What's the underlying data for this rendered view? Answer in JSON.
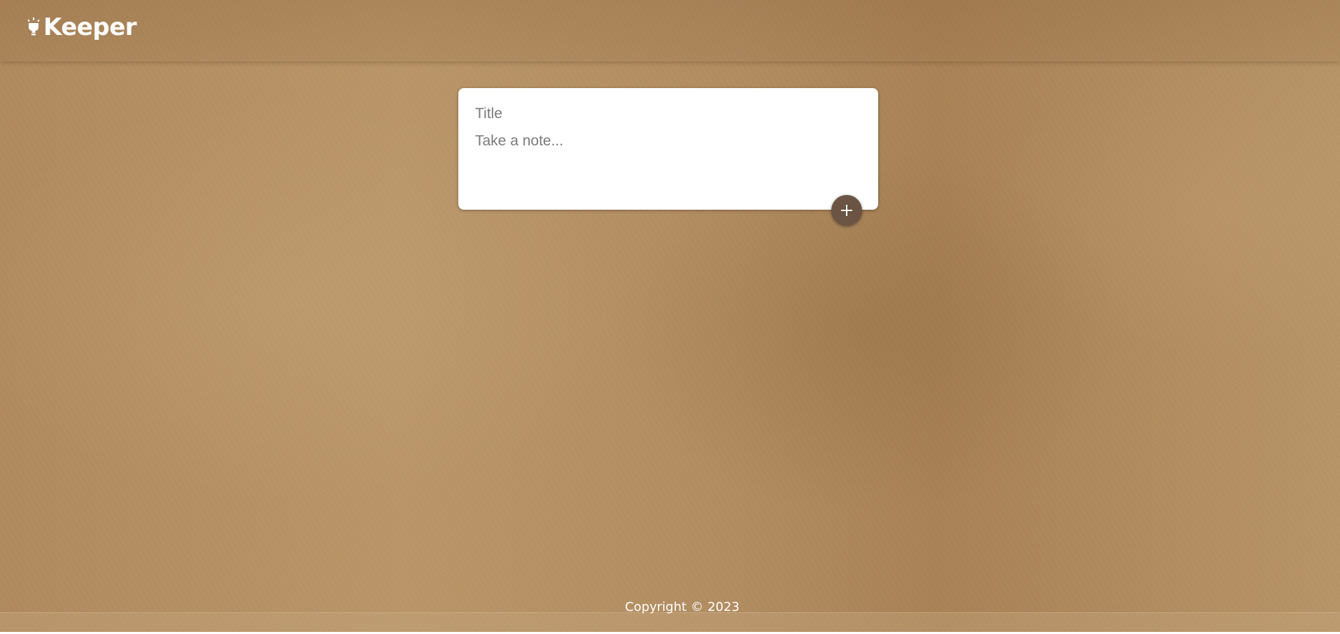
{
  "header": {
    "app_name": "Keeper",
    "logo_icon": "lightbulb-icon"
  },
  "composer": {
    "title_placeholder": "Title",
    "title_value": "",
    "content_placeholder": "Take a note...",
    "content_value": "",
    "add_button_icon": "plus-icon"
  },
  "footer": {
    "copyright_text": "Copyright",
    "copyright_symbol": "©",
    "year": "2023"
  },
  "colors": {
    "background": "#b48f63",
    "composer_background": "#ffffff",
    "add_button": "#6b5443",
    "text_light": "#ffffff"
  }
}
